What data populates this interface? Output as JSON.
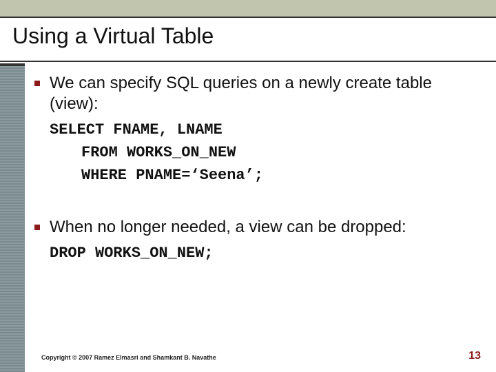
{
  "slide": {
    "title": "Using a Virtual Table",
    "bullets": [
      {
        "text": "We can specify SQL queries on a newly create table (view):",
        "code": {
          "line1": "SELECT FNAME, LNAME",
          "line2": "FROM WORKS_ON_NEW",
          "line3": "WHERE PNAME=‘Seena’;"
        }
      },
      {
        "text": "When no longer needed, a view can be dropped:",
        "code": {
          "line1": "DROP WORKS_ON_NEW;"
        }
      }
    ],
    "footer": "Copyright © 2007 Ramez Elmasri and Shamkant B. Navathe",
    "page_number": "13"
  },
  "colors": {
    "accent": "#8b1a1a",
    "band": "#c2c5ae",
    "rail": "#7a8a8f"
  }
}
